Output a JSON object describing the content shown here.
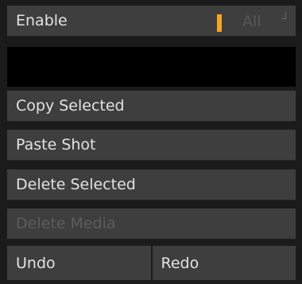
{
  "menu": {
    "enable": {
      "label": "Enable",
      "value": "All",
      "accent_color": "#f5a623"
    },
    "items": [
      {
        "label": "Copy Selected",
        "enabled": true
      },
      {
        "label": "Paste Shot",
        "enabled": true
      },
      {
        "label": "Delete Selected",
        "enabled": true
      },
      {
        "label": "Delete Media",
        "enabled": false
      }
    ],
    "undo_label": "Undo",
    "redo_label": "Redo"
  }
}
